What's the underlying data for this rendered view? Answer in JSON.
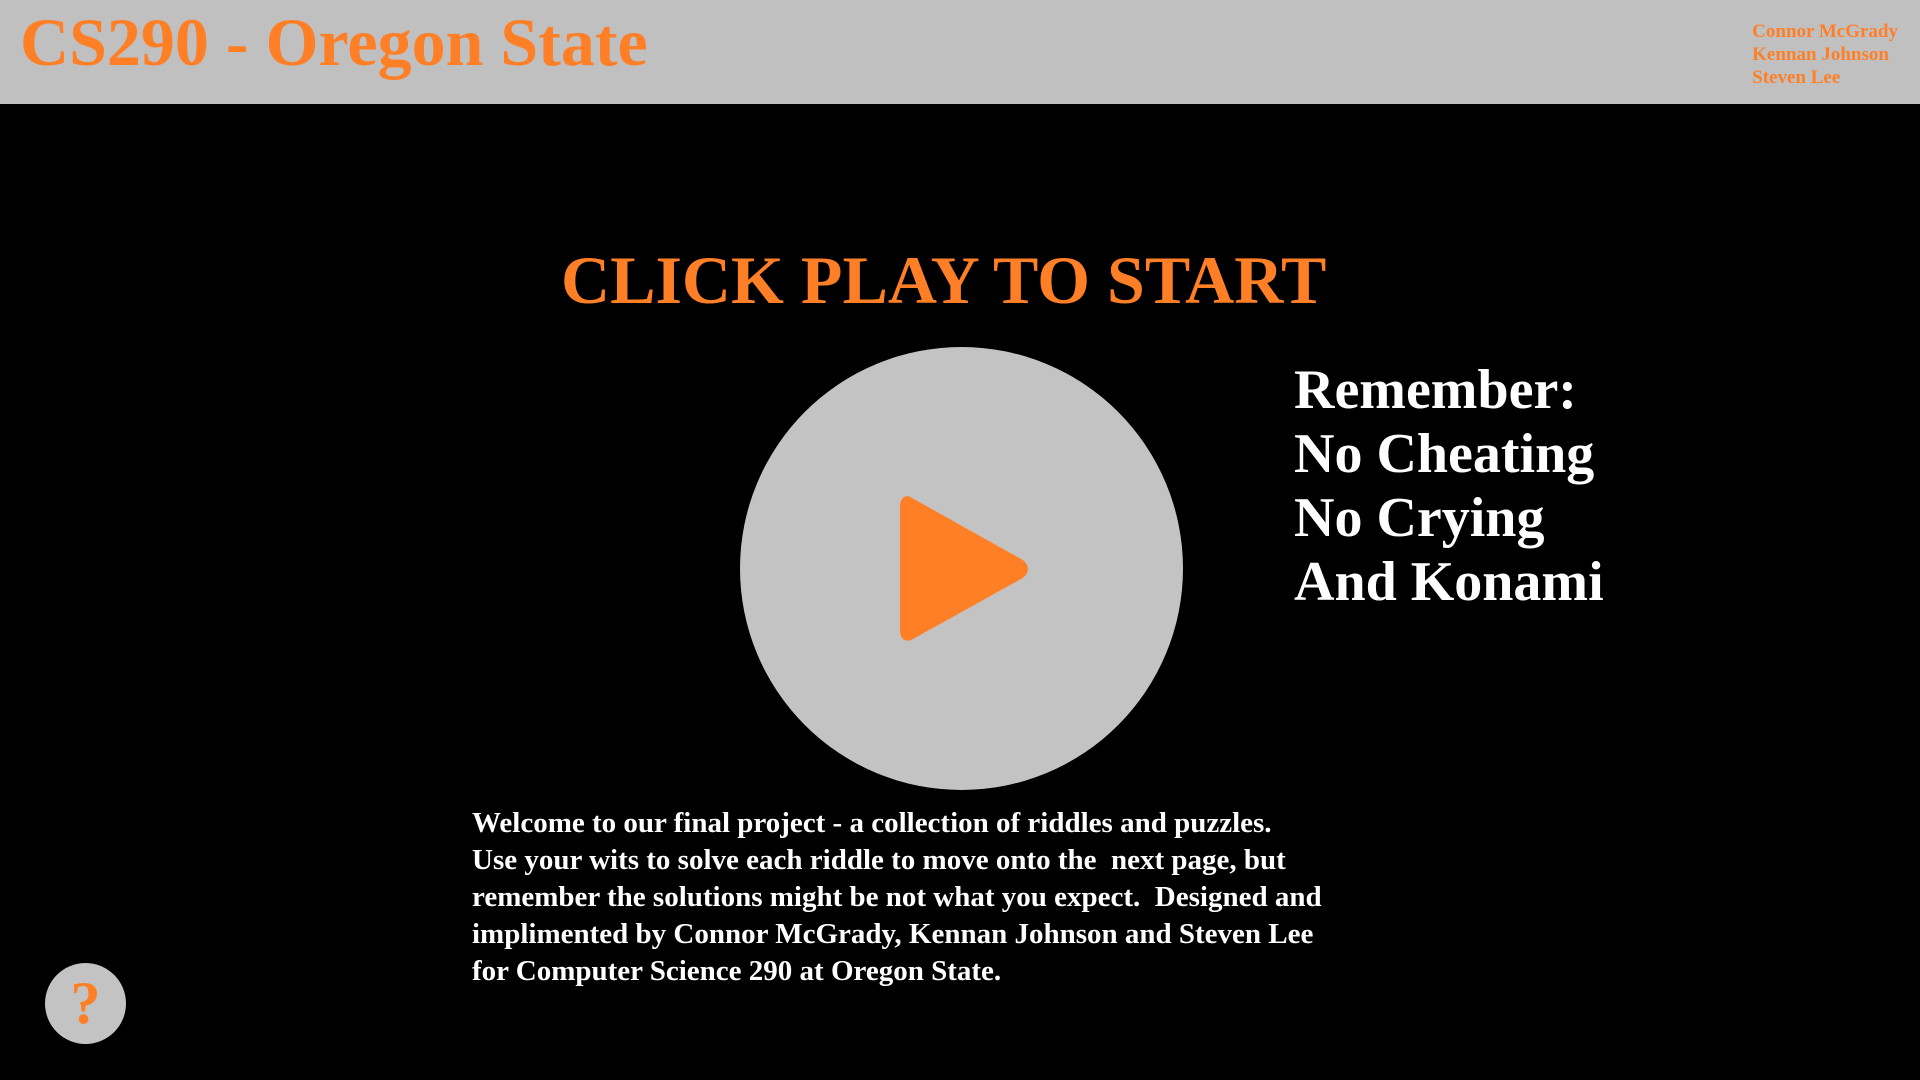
{
  "header": {
    "title": "CS290 - Oregon State",
    "authors": [
      "Connor McGrady",
      "Kennan Johnson",
      "Steven Lee"
    ]
  },
  "main": {
    "cta": "CLICK PLAY TO START",
    "play_icon": "play-icon",
    "reminder": [
      "Remember:",
      "No Cheating",
      "No Crying",
      "And Konami"
    ],
    "welcome_lines": [
      "Welcome to our final project - a collection of riddles and puzzles.",
      "Use your wits to solve each riddle to move onto the  next page, but",
      "remember the solutions might be not what you expect.  Designed and",
      "implimented by Connor McGrady, Kennan Johnson and Steven Lee",
      "for Computer Science 290 at Oregon State."
    ],
    "help_label": "?"
  },
  "colors": {
    "accent": "#ff7f27",
    "header_bg": "#c0c0c0",
    "button_bg": "#c3c3c3",
    "page_bg": "#000000",
    "text": "#ffffff"
  }
}
